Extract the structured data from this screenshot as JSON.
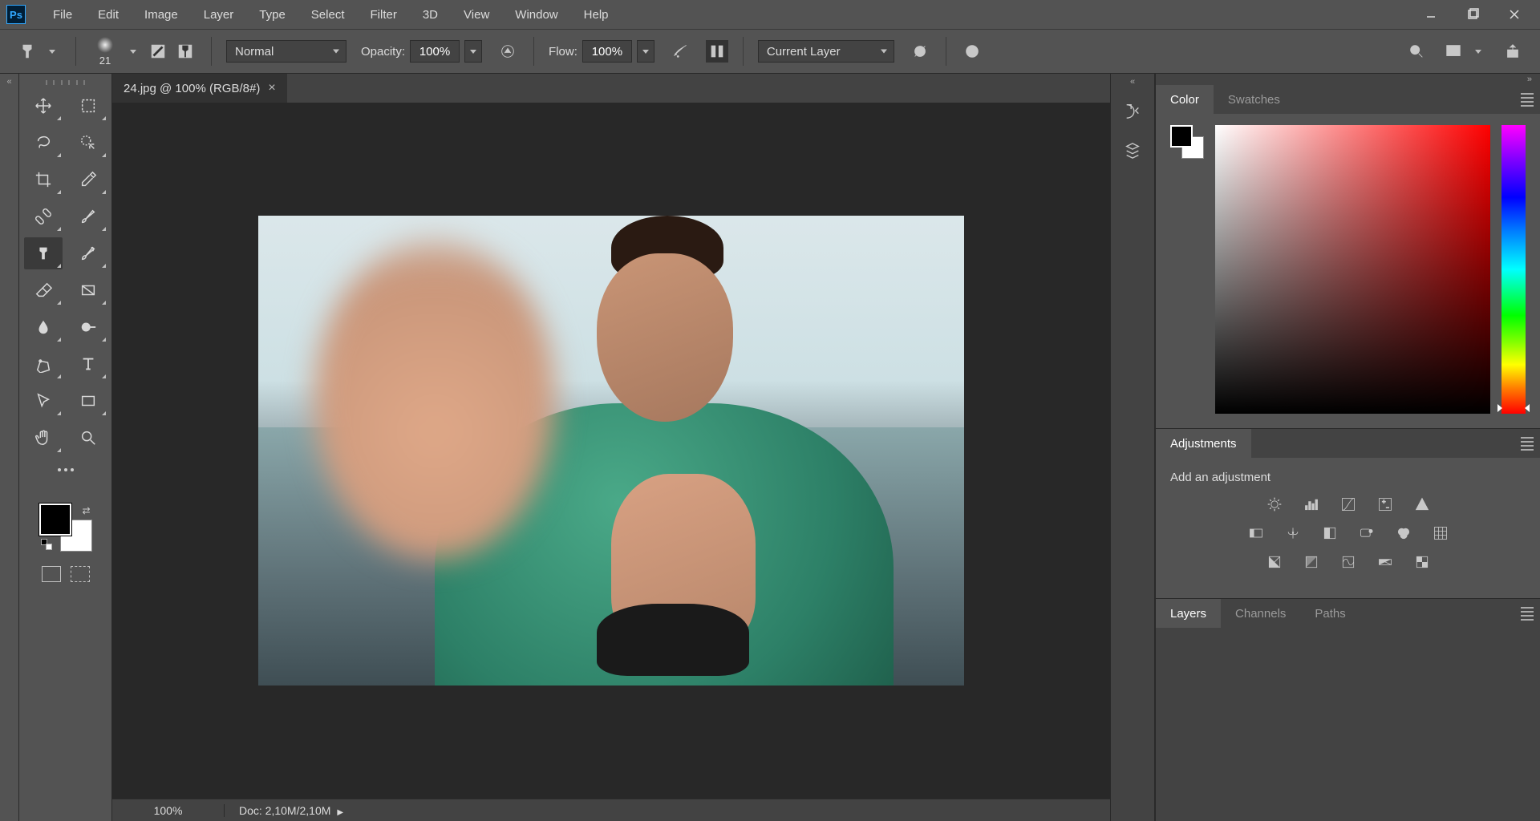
{
  "menubar": {
    "items": [
      "File",
      "Edit",
      "Image",
      "Layer",
      "Type",
      "Select",
      "Filter",
      "3D",
      "View",
      "Window",
      "Help"
    ]
  },
  "optionsbar": {
    "brush_size": "21",
    "mode_label": "Normal",
    "opacity_label": "Opacity:",
    "opacity_value": "100%",
    "flow_label": "Flow:",
    "flow_value": "100%",
    "sample_label": "Current Layer"
  },
  "document": {
    "tab_title": "24.jpg @ 100% (RGB/8#)",
    "zoom": "100%",
    "doc_info": "Doc: 2,10M/2,10M"
  },
  "tools": [
    "move-tool",
    "marquee-tool",
    "lasso-tool",
    "quick-select-tool",
    "crop-tool",
    "eyedropper-tool",
    "healing-tool",
    "brush-tool",
    "clone-stamp-tool",
    "history-brush-tool",
    "eraser-tool",
    "gradient-tool",
    "blur-tool",
    "dodge-tool",
    "pen-tool",
    "type-tool",
    "path-select-tool",
    "rectangle-tool",
    "hand-tool",
    "zoom-tool"
  ],
  "active_tool": "clone-stamp-tool",
  "panels": {
    "color_tab": "Color",
    "swatches_tab": "Swatches",
    "adjustments_tab": "Adjustments",
    "add_adjustment": "Add an adjustment",
    "layers_tab": "Layers",
    "channels_tab": "Channels",
    "paths_tab": "Paths"
  }
}
